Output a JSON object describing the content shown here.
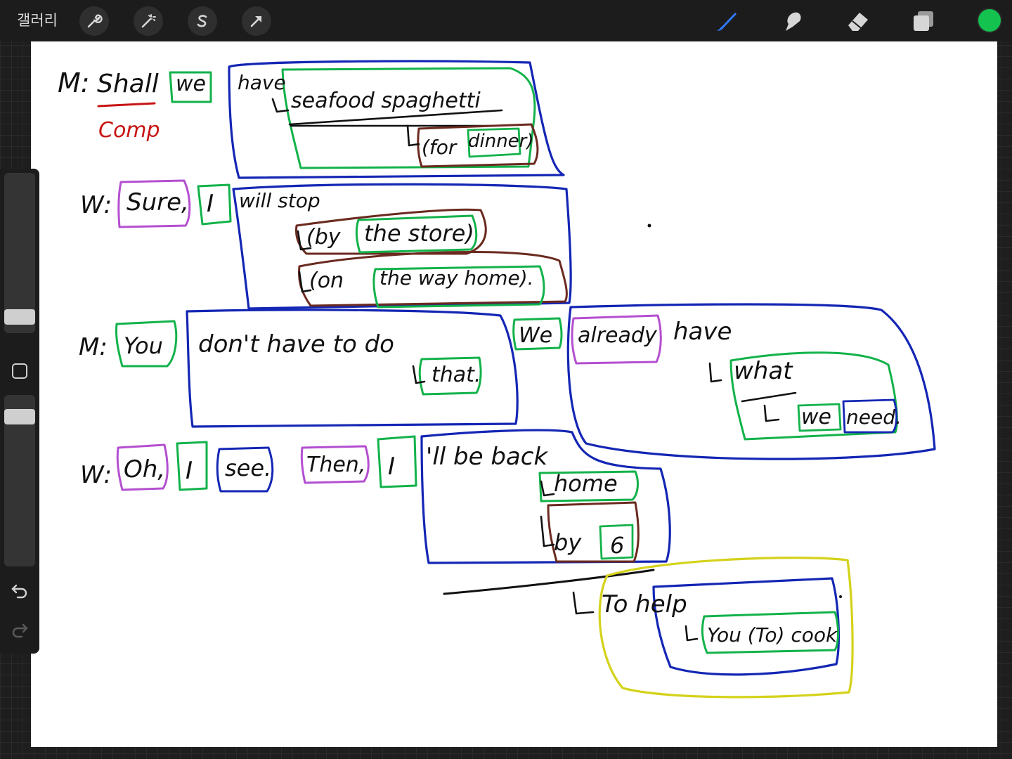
{
  "toolbar": {
    "gallery_label": "갤러리",
    "left_tools": [
      "wrench-icon",
      "magic-wand-icon",
      "selection-s-icon",
      "move-arrow-icon"
    ],
    "right_tools": [
      "brush-icon",
      "smudge-icon",
      "eraser-icon",
      "layers-icon"
    ],
    "active_color": "#14c24f",
    "brush_active_color": "#2f7bff"
  },
  "colors": {
    "blue": "#1426b4",
    "green": "#12b24a",
    "purple": "#b44fd0",
    "brown": "#6b2a1f",
    "yellow": "#d4d21a",
    "black": "#111111",
    "red": "#c81414"
  },
  "canvas": {
    "line1": {
      "speaker": "M:",
      "w1": "Shall",
      "w2": "we",
      "w3": "have",
      "w4": "seafood spaghetti",
      "w5": "(for",
      "w6": "dinner)",
      "note": "Comp"
    },
    "line2": {
      "speaker": "W:",
      "w1": "Sure,",
      "w2": "I",
      "w3": "will stop",
      "w4": "(by",
      "w5": "the store)",
      "w6": "(on",
      "w7": "the way home)."
    },
    "line3": {
      "speaker": "M:",
      "w1": "You",
      "w2": "don't have to do",
      "w3": "that.",
      "w4": "We",
      "w5": "already",
      "w6": "have",
      "w7": "what",
      "w8": "we",
      "w9": "need."
    },
    "line4": {
      "speaker": "W:",
      "w1": "Oh,",
      "w2": "I",
      "w3": "see.",
      "w4": "Then,",
      "w5": "I",
      "w6": "'ll be back",
      "w7": "home",
      "w8": "by",
      "w9": "6",
      "w10": "To help",
      "w11": "You (To) cook"
    }
  }
}
